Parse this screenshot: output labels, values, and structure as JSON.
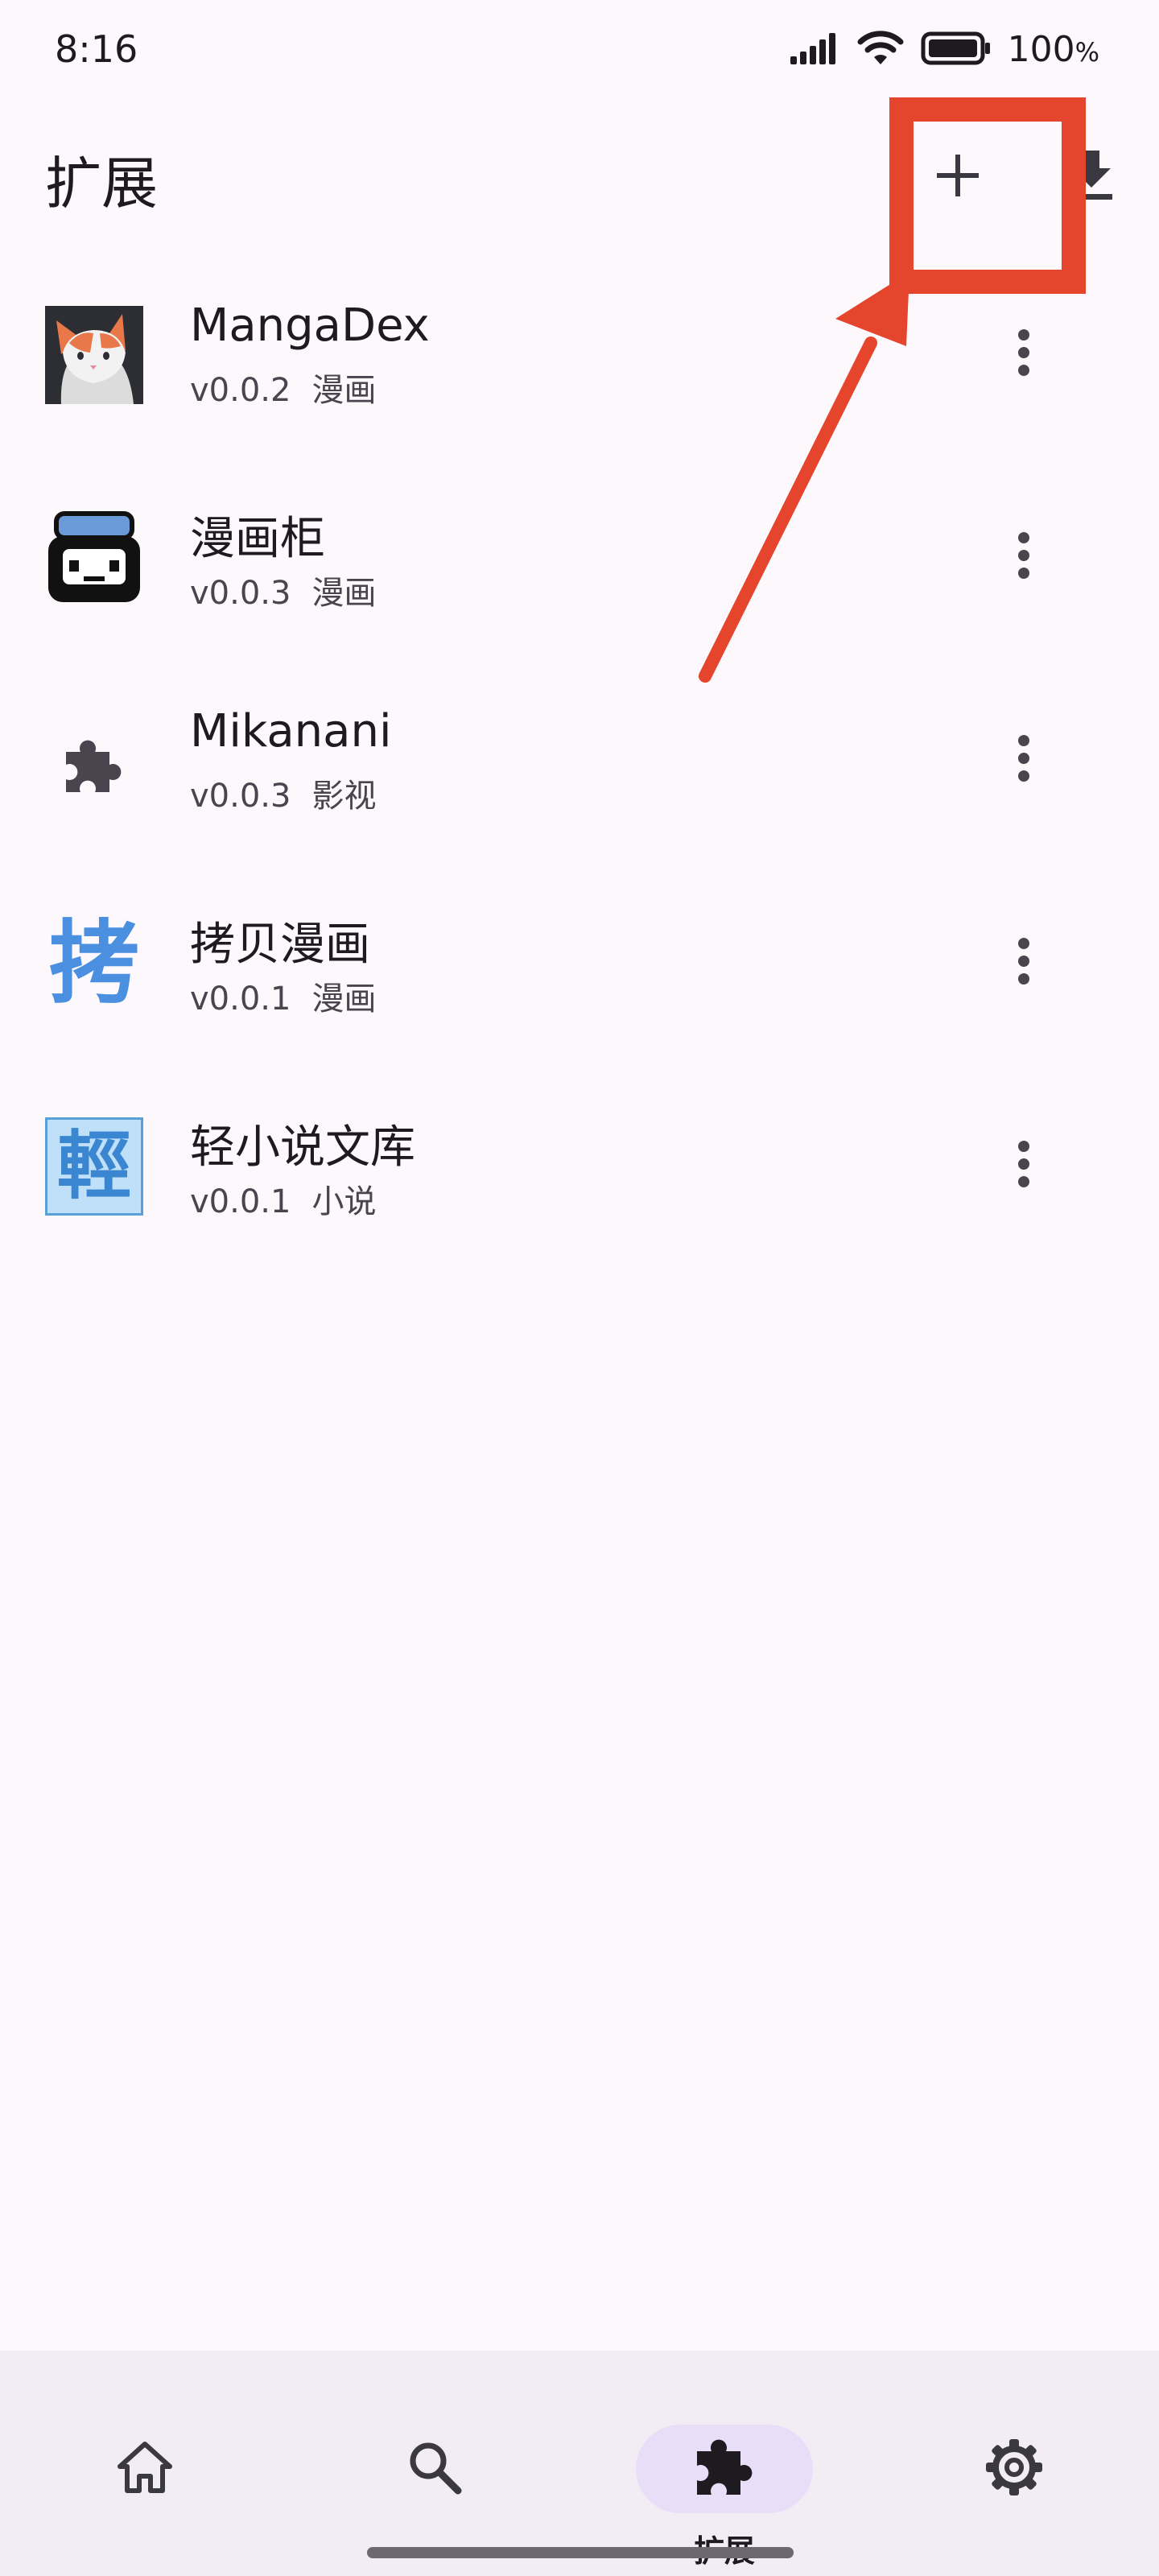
{
  "status_bar": {
    "time": "8:16",
    "battery_percent": "100",
    "battery_unit": "%"
  },
  "app_bar": {
    "title": "扩展",
    "add_icon": "plus-icon",
    "download_icon": "download-icon"
  },
  "extensions": [
    {
      "name": "MangaDex",
      "version": "v0.0.2",
      "type": "漫画",
      "icon": "mangadex-logo"
    },
    {
      "name": "漫画柜",
      "version": "v0.0.3",
      "type": "漫画",
      "icon": "manhuagui-logo"
    },
    {
      "name": "Mikanani",
      "version": "v0.0.3",
      "type": "影视",
      "icon": "puzzle-icon"
    },
    {
      "name": "拷贝漫画",
      "version": "v0.0.1",
      "type": "漫画",
      "icon": "copymanga-logo",
      "icon_text": "拷"
    },
    {
      "name": "轻小说文库",
      "version": "v0.0.1",
      "type": "小说",
      "icon": "wenku8-logo",
      "icon_text": "輕"
    }
  ],
  "bottom_nav": [
    {
      "icon": "home-icon",
      "label": "",
      "active": false
    },
    {
      "icon": "search-icon",
      "label": "",
      "active": false
    },
    {
      "icon": "extension-icon",
      "label": "扩展",
      "active": true
    },
    {
      "icon": "settings-icon",
      "label": "",
      "active": false
    }
  ],
  "colors": {
    "background": "#fcf8fc",
    "annotation": "#e4452c",
    "nav_background": "#f2ecf4",
    "nav_active_pill": "#e8def8",
    "icon": "#49454f"
  }
}
